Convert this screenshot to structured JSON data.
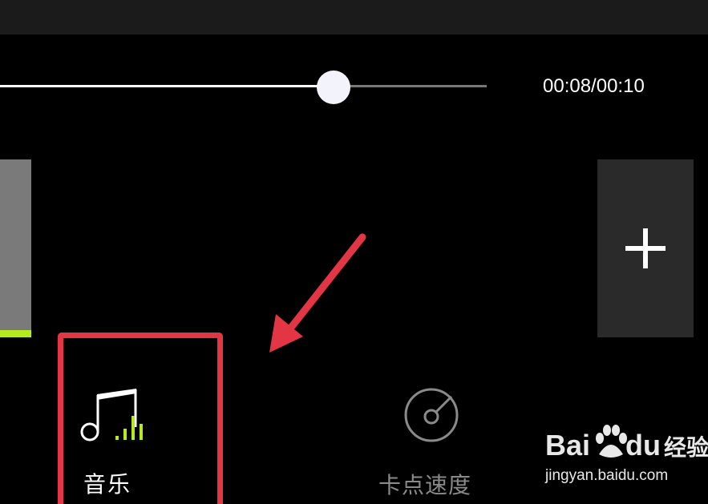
{
  "player": {
    "time_display": "00:08/00:10",
    "progress": 0.8
  },
  "toolbar": {
    "music_label": "音乐",
    "music_icon": "music-note-icon",
    "beat_label": "卡点速度",
    "beat_icon": "beat-disc-icon",
    "add_icon": "plus-icon"
  },
  "annotation": {
    "arrow_icon": "red-arrow-icon",
    "highlight_color": "#e23645"
  },
  "watermark": {
    "brand_latin": "Bai",
    "brand_latin_2": "du",
    "brand_cn": "经验",
    "url": "jingyan.baidu.com"
  },
  "colors": {
    "accent_green": "#b4ea1e",
    "annotation_red": "#e23645"
  }
}
